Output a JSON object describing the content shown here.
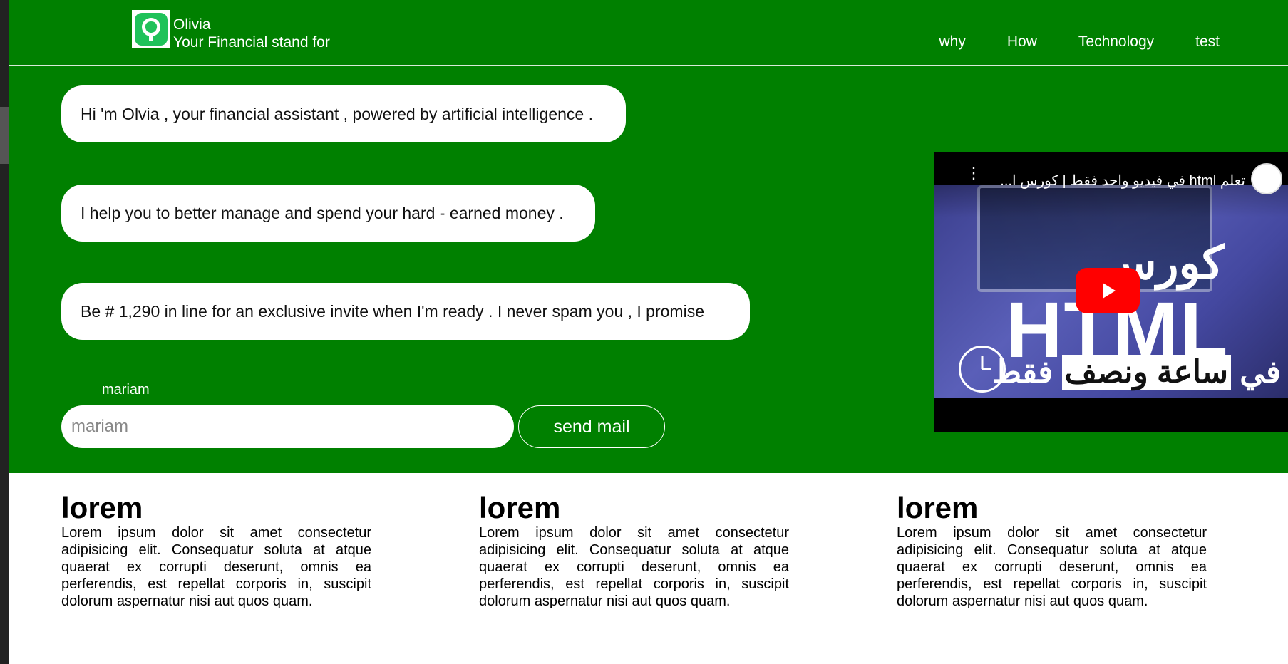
{
  "header": {
    "brand_name": "Olivia",
    "tagline": "Your Financial stand for",
    "nav": [
      "why",
      "How",
      "Technology",
      "test"
    ]
  },
  "chat": {
    "messages": [
      "Hi 'm Olvia , your financial assistant , powered by artificial intelligence .",
      "I help you to better manage and spend your hard - earned money .",
      "Be # 1,290 in line for an exclusive invite when I'm ready . I never spam you , I promise"
    ]
  },
  "form": {
    "label": "mariam",
    "input_placeholder": "mariam",
    "button_label": "send mail"
  },
  "video": {
    "title": "تعلم html في فيديو واحد فقط | كورس ا...",
    "thumb_word_top": "كورس",
    "thumb_word_main": "HTML",
    "thumb_line_a": "في",
    "thumb_line_b": "ساعة ونصف",
    "thumb_line_c": "فقط"
  },
  "columns": [
    {
      "title": "lorem",
      "text": "Lorem ipsum dolor sit amet consectetur adipisicing elit. Consequatur soluta at atque quaerat ex corrupti deserunt, omnis ea perferendis, est repellat corporis in, suscipit dolorum aspernatur nisi aut quos quam."
    },
    {
      "title": "lorem",
      "text": "Lorem ipsum dolor sit amet consectetur adipisicing elit. Consequatur soluta at atque quaerat ex corrupti deserunt, omnis ea perferendis, est repellat corporis in, suscipit dolorum aspernatur nisi aut quos quam."
    },
    {
      "title": "lorem",
      "text": "Lorem ipsum dolor sit amet consectetur adipisicing elit. Consequatur soluta at atque quaerat ex corrupti deserunt, omnis ea perferendis, est repellat corporis in, suscipit dolorum aspernatur nisi aut quos quam."
    }
  ],
  "colors": {
    "hero_bg": "#008000",
    "text_light": "#ffffff",
    "play_red": "#ff0000"
  }
}
